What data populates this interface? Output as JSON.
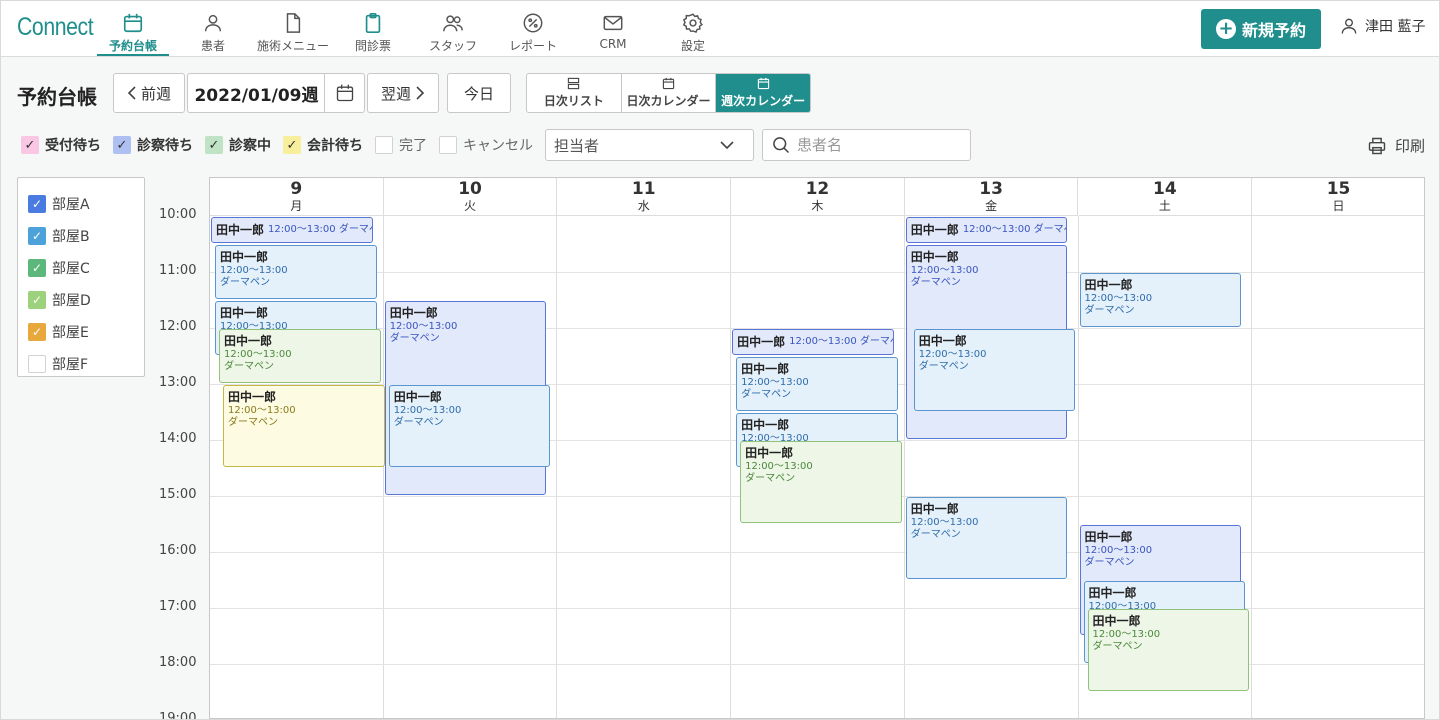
{
  "app": {
    "logo": "Connect"
  },
  "nav": [
    {
      "label": "予約台帳",
      "icon": "calendar-icon",
      "active": true
    },
    {
      "label": "患者",
      "icon": "person-icon",
      "active": false
    },
    {
      "label": "施術メニュー",
      "icon": "document-icon",
      "active": false
    },
    {
      "label": "問診票",
      "icon": "clipboard-icon",
      "active": false
    },
    {
      "label": "スタッフ",
      "icon": "people-icon",
      "active": false
    },
    {
      "label": "レポート",
      "icon": "percent-icon",
      "active": false
    },
    {
      "label": "CRM",
      "icon": "mail-icon",
      "active": false
    },
    {
      "label": "設定",
      "icon": "gear-icon",
      "active": false
    }
  ],
  "header": {
    "new_button": "新規予約",
    "user_name": "津田 藍子"
  },
  "toolbar": {
    "title": "予約台帳",
    "prev": "前週",
    "date": "2022/01/09週",
    "next": "翌週",
    "today": "今日",
    "views": [
      {
        "label": "日次リスト",
        "icon": "list-icon",
        "active": false
      },
      {
        "label": "日次カレンダー",
        "icon": "calendar-icon",
        "active": false
      },
      {
        "label": "週次カレンダー",
        "icon": "calendar-icon",
        "active": true
      }
    ]
  },
  "filters": {
    "statuses": [
      {
        "label": "受付待ち",
        "checked": true,
        "color": "#f9c7e3"
      },
      {
        "label": "診察待ち",
        "checked": true,
        "color": "#aebff2"
      },
      {
        "label": "診察中",
        "checked": true,
        "color": "#bfe3c4"
      },
      {
        "label": "会計待ち",
        "checked": true,
        "color": "#f7ef9b"
      },
      {
        "label": "完了",
        "checked": false,
        "color": "#ffffff"
      },
      {
        "label": "キャンセル",
        "checked": false,
        "color": "#ffffff"
      }
    ],
    "staff_placeholder": "担当者",
    "search_placeholder": "患者名",
    "print": "印刷"
  },
  "rooms": [
    {
      "label": "部屋A",
      "checked": true,
      "color": "#4a7be0"
    },
    {
      "label": "部屋B",
      "checked": true,
      "color": "#4da3d9"
    },
    {
      "label": "部屋C",
      "checked": true,
      "color": "#5cb87a"
    },
    {
      "label": "部屋D",
      "checked": true,
      "color": "#9cd27c"
    },
    {
      "label": "部屋E",
      "checked": true,
      "color": "#e9a83b"
    },
    {
      "label": "部屋F",
      "checked": false,
      "color": "#ffffff"
    }
  ],
  "calendar": {
    "days": [
      {
        "num": "9",
        "weekday": "月"
      },
      {
        "num": "10",
        "weekday": "火"
      },
      {
        "num": "11",
        "weekday": "水"
      },
      {
        "num": "12",
        "weekday": "木"
      },
      {
        "num": "13",
        "weekday": "金"
      },
      {
        "num": "14",
        "weekday": "土"
      },
      {
        "num": "15",
        "weekday": "日"
      }
    ],
    "hours": [
      "10:00",
      "11:00",
      "12:00",
      "13:00",
      "14:00",
      "15:00",
      "16:00",
      "17:00",
      "18:00",
      "19:00"
    ],
    "events": [
      {
        "day": 0,
        "start": 10.0,
        "end": 10.5,
        "name": "田中一郎",
        "time": "12:00〜13:00",
        "treatment": "ダーマペン",
        "color": "blue",
        "compact": true,
        "lane": 0
      },
      {
        "day": 0,
        "start": 10.5,
        "end": 11.5,
        "name": "田中一郎",
        "time": "12:00〜13:00",
        "treatment": "ダーマペン",
        "color": "sky",
        "lane": 1
      },
      {
        "day": 0,
        "start": 11.5,
        "end": 12.5,
        "name": "田中一郎",
        "time": "12:00〜13:00",
        "treatment": "ダーマペン",
        "color": "sky",
        "lane": 1
      },
      {
        "day": 0,
        "start": 12.0,
        "end": 13.0,
        "name": "田中一郎",
        "time": "12:00〜13:00",
        "treatment": "ダーマペン",
        "color": "green",
        "lane": 2
      },
      {
        "day": 0,
        "start": 13.0,
        "end": 14.5,
        "name": "田中一郎",
        "time": "12:00〜13:00",
        "treatment": "ダーマペン",
        "color": "yellow",
        "lane": 3
      },
      {
        "day": 1,
        "start": 11.5,
        "end": 15.0,
        "name": "田中一郎",
        "time": "12:00〜13:00",
        "treatment": "ダーマペン",
        "color": "blue",
        "lane": 0
      },
      {
        "day": 1,
        "start": 13.0,
        "end": 14.5,
        "name": "田中一郎",
        "time": "12:00〜13:00",
        "treatment": "ダーマペン",
        "color": "sky",
        "lane": 1
      },
      {
        "day": 3,
        "start": 12.0,
        "end": 12.5,
        "name": "田中一郎",
        "time": "12:00〜13:00",
        "treatment": "ダーマペン",
        "color": "blue",
        "compact": true,
        "lane": 0
      },
      {
        "day": 3,
        "start": 12.5,
        "end": 13.5,
        "name": "田中一郎",
        "time": "12:00〜13:00",
        "treatment": "ダーマペン",
        "color": "sky",
        "lane": 1
      },
      {
        "day": 3,
        "start": 13.5,
        "end": 14.5,
        "name": "田中一郎",
        "time": "12:00〜13:00",
        "treatment": "ダーマペン",
        "color": "sky",
        "lane": 1
      },
      {
        "day": 3,
        "start": 14.0,
        "end": 15.5,
        "name": "田中一郎",
        "time": "12:00〜13:00",
        "treatment": "ダーマペン",
        "color": "green",
        "lane": 2
      },
      {
        "day": 4,
        "start": 10.0,
        "end": 10.5,
        "name": "田中一郎",
        "time": "12:00〜13:00",
        "treatment": "ダーマペン",
        "color": "blue",
        "compact": true,
        "lane": 0
      },
      {
        "day": 4,
        "start": 10.5,
        "end": 14.0,
        "name": "田中一郎",
        "time": "12:00〜13:00",
        "treatment": "ダーマペン",
        "color": "blue",
        "lane": 0
      },
      {
        "day": 4,
        "start": 12.0,
        "end": 13.5,
        "name": "田中一郎",
        "time": "12:00〜13:00",
        "treatment": "ダーマペン",
        "color": "sky",
        "lane": 2
      },
      {
        "day": 4,
        "start": 15.0,
        "end": 16.5,
        "name": "田中一郎",
        "time": "12:00〜13:00",
        "treatment": "ダーマペン",
        "color": "sky",
        "lane": 0
      },
      {
        "day": 5,
        "start": 11.0,
        "end": 12.0,
        "name": "田中一郎",
        "time": "12:00〜13:00",
        "treatment": "ダーマペン",
        "color": "sky",
        "lane": 0
      },
      {
        "day": 5,
        "start": 15.5,
        "end": 17.5,
        "name": "田中一郎",
        "time": "12:00〜13:00",
        "treatment": "ダーマペン",
        "color": "blue",
        "lane": 0
      },
      {
        "day": 5,
        "start": 16.5,
        "end": 18.0,
        "name": "田中一郎",
        "time": "12:00〜13:00",
        "treatment": "ダーマペン",
        "color": "sky",
        "lane": 1
      },
      {
        "day": 5,
        "start": 17.0,
        "end": 18.5,
        "name": "田中一郎",
        "time": "12:00〜13:00",
        "treatment": "ダーマペン",
        "color": "green",
        "lane": 2
      }
    ]
  }
}
